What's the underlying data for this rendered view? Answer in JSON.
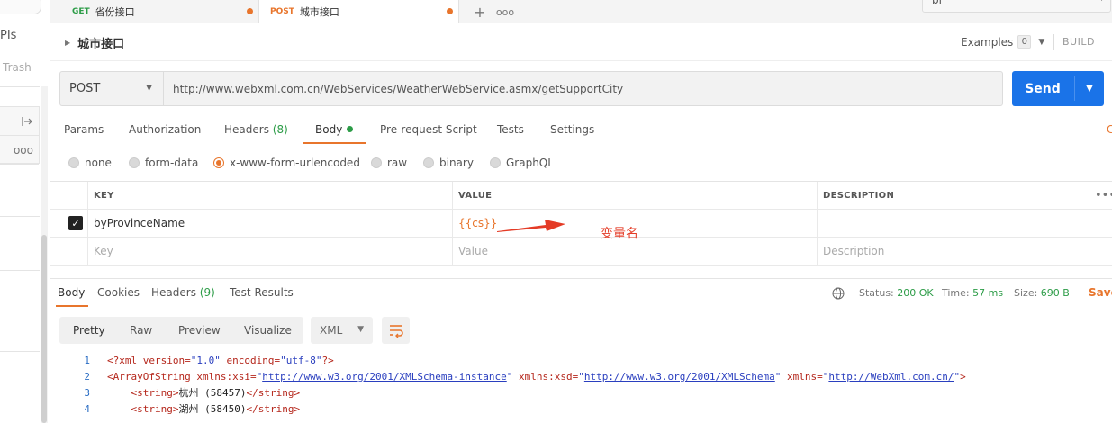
{
  "sidebar": {
    "apis_label": "PIs",
    "trash_label": "Trash",
    "pane_more": "ooo"
  },
  "tabs": [
    {
      "method": "GET",
      "name": "省份接口",
      "method_color": "#2c9c47"
    },
    {
      "method": "POST",
      "name": "城市接口",
      "method_color": "#e8752c"
    }
  ],
  "tabbar": {
    "new_tab": "+",
    "more": "ooo"
  },
  "environment": {
    "selected": "bi"
  },
  "request": {
    "name": "城市接口",
    "examples_label": "Examples",
    "examples_count": "0",
    "build_label": "BUILD",
    "method": "POST",
    "url": "http://www.webxml.com.cn/WebServices/WeatherWebService.asmx/getSupportCity",
    "send_label": "Send"
  },
  "request_tabs": {
    "params": "Params",
    "authorization": "Authorization",
    "headers": "Headers",
    "headers_count": "(8)",
    "body": "Body",
    "prerequest": "Pre-request Script",
    "tests": "Tests",
    "settings": "Settings",
    "right_cut": "C"
  },
  "body_types": [
    {
      "label": "none",
      "selected": false
    },
    {
      "label": "form-data",
      "selected": false
    },
    {
      "label": "x-www-form-urlencoded",
      "selected": true
    },
    {
      "label": "raw",
      "selected": false
    },
    {
      "label": "binary",
      "selected": false
    },
    {
      "label": "GraphQL",
      "selected": false
    }
  ],
  "kv_table": {
    "headers": {
      "key": "KEY",
      "value": "VALUE",
      "description": "DESCRIPTION",
      "more": "•••"
    },
    "rows": [
      {
        "checked": true,
        "key": "byProvinceName",
        "value": "{{cs}}",
        "description": ""
      }
    ],
    "placeholder": {
      "key": "Key",
      "value": "Value",
      "description": "Description"
    }
  },
  "annotation": {
    "text": "变量名",
    "color": "#e43b26"
  },
  "response_tabs": {
    "body": "Body",
    "cookies": "Cookies",
    "headers": "Headers",
    "headers_count": "(9)",
    "test_results": "Test Results"
  },
  "response_status": {
    "status_label": "Status:",
    "status_value": "200 OK",
    "time_label": "Time:",
    "time_value": "57 ms",
    "size_label": "Size:",
    "size_value": "690 B",
    "save_label": "Save"
  },
  "view": {
    "pretty": "Pretty",
    "raw": "Raw",
    "preview": "Preview",
    "visualize": "Visualize",
    "format": "XML"
  },
  "code_lines": [
    {
      "num": "1",
      "parts": [
        [
          "tag",
          "<?xml "
        ],
        [
          "attr",
          "version="
        ],
        [
          "val",
          "\"1.0\""
        ],
        [
          "attr",
          " encoding="
        ],
        [
          "val",
          "\"utf-8\""
        ],
        [
          "tag",
          "?>"
        ]
      ]
    },
    {
      "num": "2",
      "parts": [
        [
          "tag",
          "<ArrayOfString "
        ],
        [
          "attr",
          "xmlns:xsi="
        ],
        [
          "val",
          "\""
        ],
        [
          "link",
          "http://www.w3.org/2001/XMLSchema-instance"
        ],
        [
          "val",
          "\""
        ],
        [
          "attr",
          " xmlns:xsd="
        ],
        [
          "val",
          "\""
        ],
        [
          "link",
          "http://www.w3.org/2001/XMLSchema"
        ],
        [
          "val",
          "\""
        ],
        [
          "attr",
          " xmlns="
        ],
        [
          "val",
          "\""
        ],
        [
          "link",
          "http://WebXml.com.cn/"
        ],
        [
          "val",
          "\""
        ],
        [
          "tag",
          ">"
        ]
      ]
    },
    {
      "num": "3",
      "parts": [
        [
          "txt",
          "    "
        ],
        [
          "tag",
          "<string>"
        ],
        [
          "txt",
          "杭州 (58457)"
        ],
        [
          "tag",
          "</string>"
        ]
      ]
    },
    {
      "num": "4",
      "parts": [
        [
          "txt",
          "    "
        ],
        [
          "tag",
          "<string>"
        ],
        [
          "txt",
          "湖州 (58450)"
        ],
        [
          "tag",
          "</string>"
        ]
      ]
    }
  ],
  "colors": {
    "accent": "#e8752c",
    "send": "#1a73e8",
    "success": "#2c9c47"
  }
}
